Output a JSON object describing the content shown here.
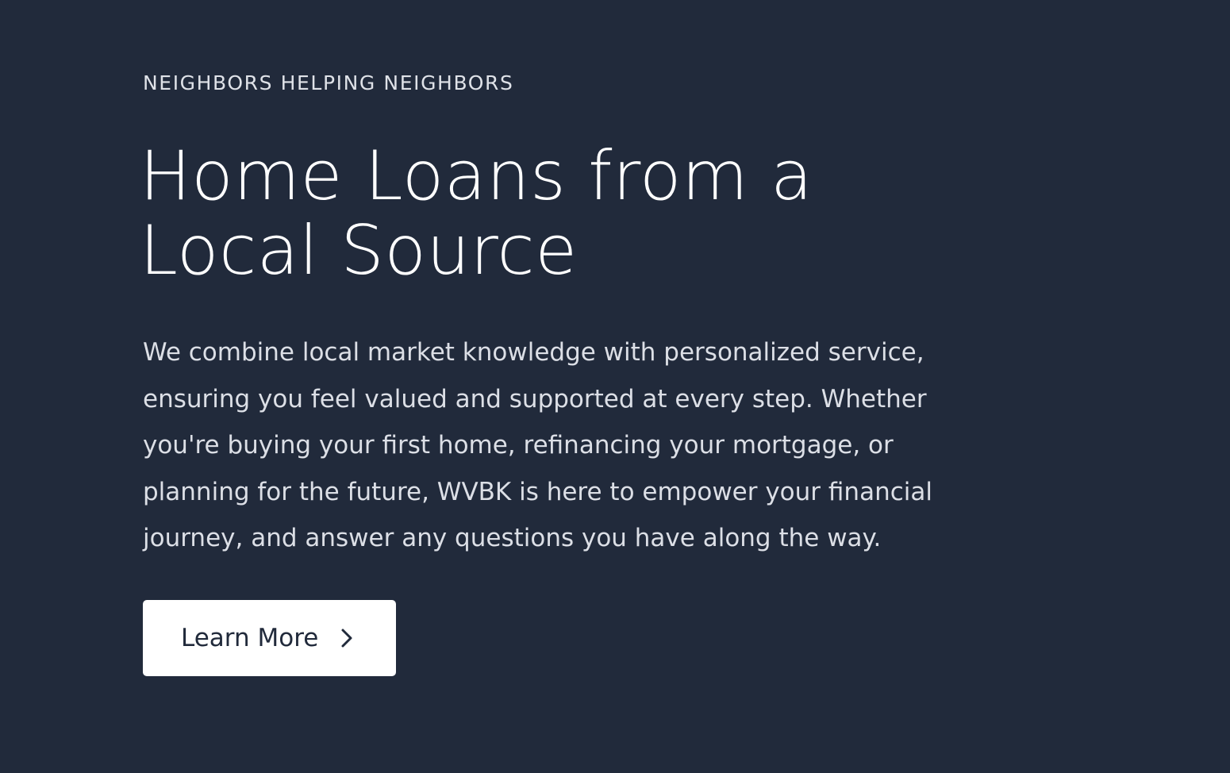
{
  "hero": {
    "eyebrow": "NEIGHBORS HELPING NEIGHBORS",
    "headline_lines": [
      "Home Loans from a",
      "Local Source"
    ],
    "body_lines": [
      "We combine local market knowledge with personalized service,",
      "ensuring you feel valued and supported at every step. Whether",
      "you're buying your first home, refinancing your mortgage, or",
      "planning for the future, WVBK is here to empower your financial",
      "journey, and answer any questions you have along the way."
    ],
    "cta": {
      "label": "Learn More",
      "icon": "chevron-right-icon"
    }
  },
  "colors": {
    "background": "#212a3b",
    "text_primary": "#ffffff",
    "text_secondary": "#dcdfe6",
    "button_background": "#ffffff",
    "button_text": "#212a3b"
  }
}
